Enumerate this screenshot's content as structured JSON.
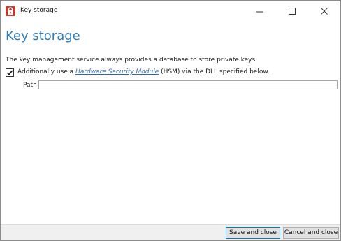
{
  "window": {
    "title": "Key storage",
    "icon": "red-lock-icon"
  },
  "page": {
    "title": "Key storage",
    "description": "The key management service always provides a database to store private keys.",
    "hsm_option": {
      "checked": true,
      "text_before": "Additionally use a ",
      "link_text": "Hardware Security Module",
      "text_after": " (HSM) via the DLL specified below."
    },
    "path": {
      "label": "Path",
      "value": ""
    }
  },
  "footer": {
    "save_label": "Save and close",
    "cancel_label": "Cancel and close"
  },
  "colors": {
    "accent": "#2f7ab8",
    "link": "#2d6bb0",
    "icon": "#d0342c"
  }
}
